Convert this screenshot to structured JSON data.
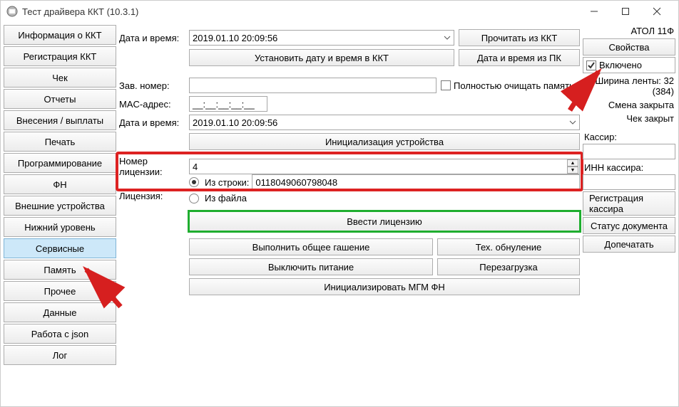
{
  "window": {
    "title": "Тест драйвера ККТ (10.3.1)"
  },
  "sidebar": {
    "items": [
      {
        "label": "Информация о ККТ"
      },
      {
        "label": "Регистрация ККТ"
      },
      {
        "label": "Чек"
      },
      {
        "label": "Отчеты"
      },
      {
        "label": "Внесения / выплаты"
      },
      {
        "label": "Печать"
      },
      {
        "label": "Программирование"
      },
      {
        "label": "ФН"
      },
      {
        "label": "Внешние устройства"
      },
      {
        "label": "Нижний уровень"
      },
      {
        "label": "Сервисные",
        "active": true
      },
      {
        "label": "Память"
      },
      {
        "label": "Прочее"
      },
      {
        "label": "Данные"
      },
      {
        "label": "Работа с json"
      },
      {
        "label": "Лог"
      }
    ]
  },
  "center": {
    "datetime_label": "Дата и время:",
    "datetime_value": "2019.01.10 20:09:56",
    "read_from_kkt": "Прочитать из ККТ",
    "set_datetime_kkt": "Установить дату и время в ККТ",
    "datetime_from_pc": "Дата и время из ПК",
    "serial_label": "Зав. номер:",
    "serial_value": "",
    "clear_memory_label": "Полностью очищать память",
    "mac_label": "MAC-адрес:",
    "mac_value": "__:__:__:__:__",
    "datetime2_label": "Дата и время:",
    "datetime2_value": "2019.01.10 20:09:56",
    "init_device": "Инициализация устройства",
    "license_no_label": "Номер лицензии:",
    "license_no_value": "4",
    "license_label": "Лицензия:",
    "license_from_string": "Из строки:",
    "license_string_value": "0118049060798048",
    "license_from_file": "Из файла",
    "enter_license": "Ввести лицензию",
    "erase_all": "Выполнить общее гашение",
    "tech_reset": "Тех. обнуление",
    "power_off": "Выключить питание",
    "reboot": "Перезагрузка",
    "init_mgm": "Инициализировать МГМ ФН"
  },
  "right": {
    "device_model": "АТОЛ 11Ф",
    "properties": "Свойства",
    "enabled_label": "Включено",
    "tape_width": "Ширина ленты: 32 (384)",
    "shift_closed": "Смена закрыта",
    "check_closed": "Чек закрыт",
    "cashier_label": "Кассир:",
    "cashier_inn_label": "ИНН кассира:",
    "register_cashier": "Регистрация кассира",
    "doc_status": "Статус документа",
    "reprint": "Допечатать"
  },
  "colors": {
    "highlight_red": "#d22",
    "highlight_green": "#1fae2f",
    "arrow": "#d61f1f"
  }
}
